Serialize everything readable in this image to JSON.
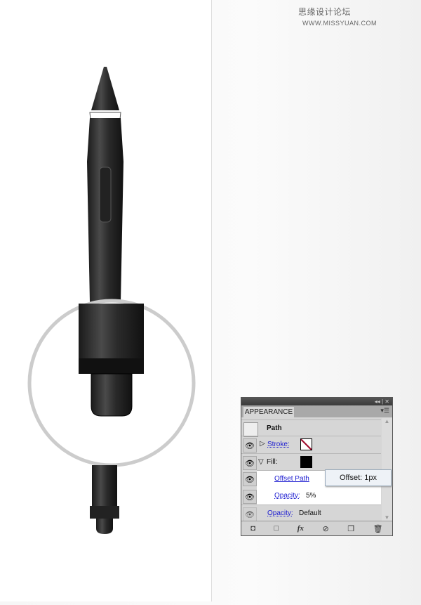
{
  "watermark": {
    "cn": "思缘设计论坛",
    "url": "WWW.MISSYUAN.COM"
  },
  "panel": {
    "titlebar_buttons": "◂◂ | ✕",
    "tab": "APPEARANCE",
    "menu_icon": "menu-icon",
    "rows": [
      {
        "label": "Path"
      },
      {
        "label": "Stroke:",
        "swatch": "none"
      },
      {
        "label": "Fill:",
        "swatch": "#000000"
      },
      {
        "label": "Offset Path"
      },
      {
        "label": "Opacity:",
        "value": "5%"
      },
      {
        "label": "Opacity:",
        "value": "Default"
      }
    ],
    "toolbar": [
      "new-art-icon",
      "clear-icon",
      "fx-icon",
      "no-icon",
      "duplicate-icon",
      "trash-icon"
    ],
    "fx_label": "fx"
  },
  "tooltip": "Offset: 1px"
}
